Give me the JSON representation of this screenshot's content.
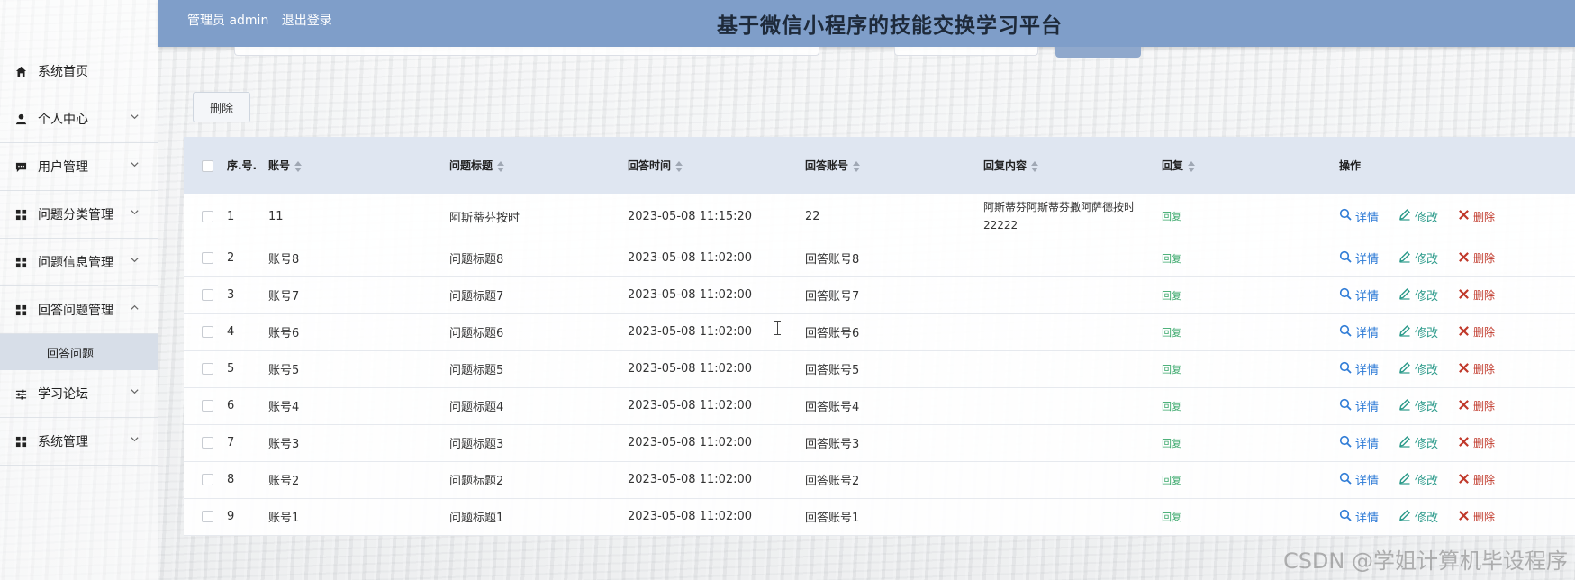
{
  "header": {
    "user_label": "管理员 admin",
    "logout_label": "退出登录",
    "title": "基于微信小程序的技能交换学习平台"
  },
  "sidebar": {
    "items": [
      {
        "label": "系统首页",
        "icon": "home-icon",
        "expandable": false
      },
      {
        "label": "个人中心",
        "icon": "user-icon",
        "expandable": true
      },
      {
        "label": "用户管理",
        "icon": "chat-icon",
        "expandable": true
      },
      {
        "label": "问题分类管理",
        "icon": "grid-icon",
        "expandable": true
      },
      {
        "label": "问题信息管理",
        "icon": "grid-icon",
        "expandable": true
      },
      {
        "label": "回答问题管理",
        "icon": "grid-icon",
        "expandable": true,
        "expanded": true
      },
      {
        "label": "学习论坛",
        "icon": "sliders-icon",
        "expandable": true
      },
      {
        "label": "系统管理",
        "icon": "grid-icon",
        "expandable": true
      }
    ],
    "submenu": {
      "label": "回答问题"
    }
  },
  "toolbar": {
    "delete_label": "删除"
  },
  "table": {
    "columns": [
      "序.号.",
      "账号",
      "问题标题",
      "回答时间",
      "回答账号",
      "回复内容",
      "回复",
      "操作"
    ],
    "rows": [
      {
        "index": "1",
        "account": "11",
        "title": "阿斯蒂芬按时",
        "time": "2023-05-08 11:15:20",
        "answer_account": "22",
        "content": "阿斯蒂芬阿斯蒂芬撒阿萨德按时22222",
        "reply": "回复"
      },
      {
        "index": "2",
        "account": "账号8",
        "title": "问题标题8",
        "time": "2023-05-08 11:02:00",
        "answer_account": "回答账号8",
        "content": "",
        "reply": "回复"
      },
      {
        "index": "3",
        "account": "账号7",
        "title": "问题标题7",
        "time": "2023-05-08 11:02:00",
        "answer_account": "回答账号7",
        "content": "",
        "reply": "回复"
      },
      {
        "index": "4",
        "account": "账号6",
        "title": "问题标题6",
        "time": "2023-05-08 11:02:00",
        "answer_account": "回答账号6",
        "content": "",
        "reply": "回复"
      },
      {
        "index": "5",
        "account": "账号5",
        "title": "问题标题5",
        "time": "2023-05-08 11:02:00",
        "answer_account": "回答账号5",
        "content": "",
        "reply": "回复"
      },
      {
        "index": "6",
        "account": "账号4",
        "title": "问题标题4",
        "time": "2023-05-08 11:02:00",
        "answer_account": "回答账号4",
        "content": "",
        "reply": "回复"
      },
      {
        "index": "7",
        "account": "账号3",
        "title": "问题标题3",
        "time": "2023-05-08 11:02:00",
        "answer_account": "回答账号3",
        "content": "",
        "reply": "回复"
      },
      {
        "index": "8",
        "account": "账号2",
        "title": "问题标题2",
        "time": "2023-05-08 11:02:00",
        "answer_account": "回答账号2",
        "content": "",
        "reply": "回复"
      },
      {
        "index": "9",
        "account": "账号1",
        "title": "问题标题1",
        "time": "2023-05-08 11:02:00",
        "answer_account": "回答账号1",
        "content": "",
        "reply": "回复"
      }
    ],
    "actions": {
      "detail": "详情",
      "edit": "修改",
      "delete": "删除"
    }
  },
  "watermark": "CSDN @学姐计算机毕设程序",
  "colors": {
    "header_bg": "#7f9ec9",
    "detail": "#2e7bd6",
    "edit": "#2b9a8a",
    "delete": "#c0392b",
    "reply": "#3aa86b"
  }
}
